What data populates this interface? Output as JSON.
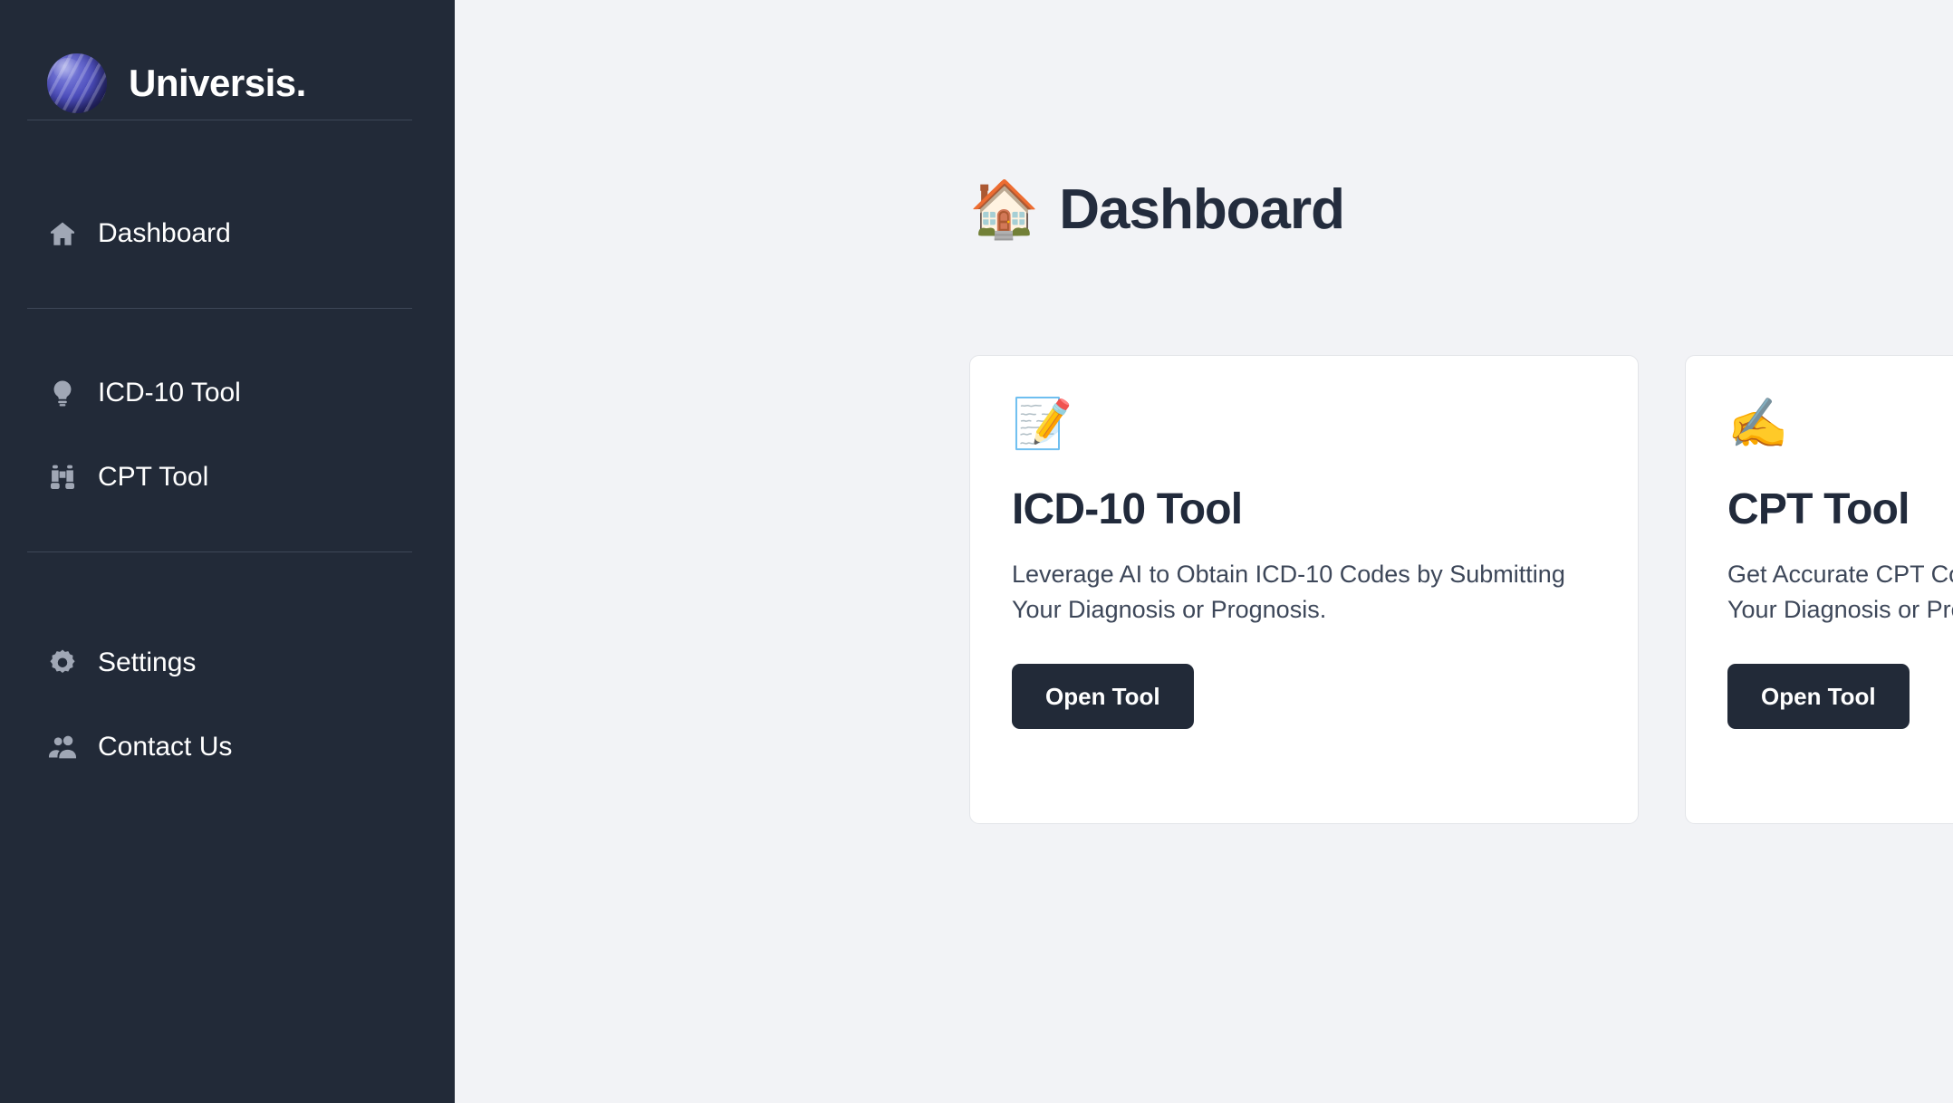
{
  "brand": {
    "name": "Universis.",
    "logo_icon": "planet-sphere-logo",
    "logo_color": "#4b4cbb"
  },
  "theme": {
    "sidebar_bg": "#222a38",
    "main_bg": "#f2f3f6",
    "card_bg": "#ffffff",
    "card_border": "#e3e5e9",
    "text_dark": "#212a3b",
    "button_bg": "#222a38",
    "nav_icon": "#a0a7b5",
    "divider": "#3d4757"
  },
  "sidebar": {
    "groups": [
      {
        "items": [
          {
            "label": "Dashboard",
            "icon": "home-icon"
          }
        ]
      },
      {
        "items": [
          {
            "label": "ICD-10 Tool",
            "icon": "lightbulb-icon"
          },
          {
            "label": "CPT Tool",
            "icon": "binoculars-icon"
          }
        ]
      },
      {
        "items": [
          {
            "label": "Settings",
            "icon": "gear-icon"
          },
          {
            "label": "Contact Us",
            "icon": "people-icon"
          }
        ]
      }
    ]
  },
  "main": {
    "page_title": {
      "emoji": "🏠",
      "emoji_name": "house-emoji",
      "text": "Dashboard"
    },
    "cards": [
      {
        "emoji": "📝",
        "emoji_name": "memo-emoji",
        "title": "ICD-10 Tool",
        "description": "Leverage AI to Obtain ICD-10 Codes by Submitting Your Diagnosis or Prognosis.",
        "button_label": "Open Tool"
      },
      {
        "emoji": "✍️",
        "emoji_name": "writing-hand-emoji",
        "title": "CPT Tool",
        "description": "Get Accurate CPT Codes with AI by Submitting Your Diagnosis or Prognosis.",
        "button_label": "Open Tool"
      }
    ]
  }
}
